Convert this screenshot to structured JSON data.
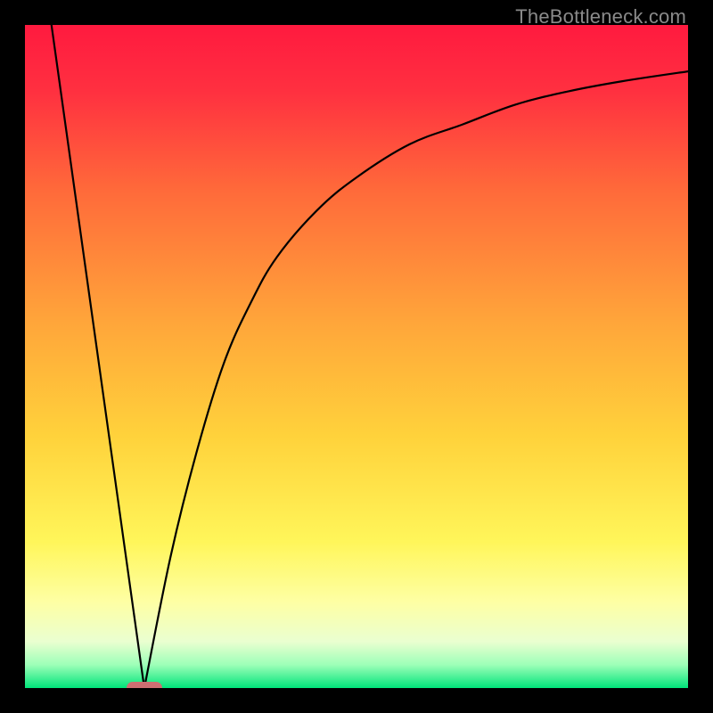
{
  "watermark": "TheBottleneck.com",
  "chart_data": {
    "type": "line",
    "title": "",
    "xlabel": "",
    "ylabel": "",
    "xlim": [
      0,
      100
    ],
    "ylim": [
      0,
      100
    ],
    "background": {
      "kind": "vertical-gradient",
      "stops": [
        {
          "pos": 0.0,
          "color": "#ff1a3f"
        },
        {
          "pos": 0.1,
          "color": "#ff3040"
        },
        {
          "pos": 0.25,
          "color": "#ff6a3a"
        },
        {
          "pos": 0.45,
          "color": "#ffa63a"
        },
        {
          "pos": 0.62,
          "color": "#ffd23b"
        },
        {
          "pos": 0.78,
          "color": "#fff65a"
        },
        {
          "pos": 0.87,
          "color": "#feffa4"
        },
        {
          "pos": 0.93,
          "color": "#eaffd0"
        },
        {
          "pos": 0.965,
          "color": "#9dffb8"
        },
        {
          "pos": 1.0,
          "color": "#00e57a"
        }
      ]
    },
    "series": [
      {
        "name": "left-branch",
        "x": [
          4,
          18
        ],
        "y": [
          100,
          0
        ]
      },
      {
        "name": "right-branch",
        "x": [
          18,
          22,
          26,
          30,
          34,
          38,
          44,
          50,
          58,
          66,
          74,
          82,
          90,
          100
        ],
        "y": [
          0,
          20,
          36,
          49,
          58,
          65,
          72,
          77,
          82,
          85,
          88,
          90,
          91.5,
          93
        ]
      }
    ],
    "marker": {
      "x": 18,
      "y": 0,
      "color": "#cd6f72",
      "shape": "pill"
    }
  }
}
